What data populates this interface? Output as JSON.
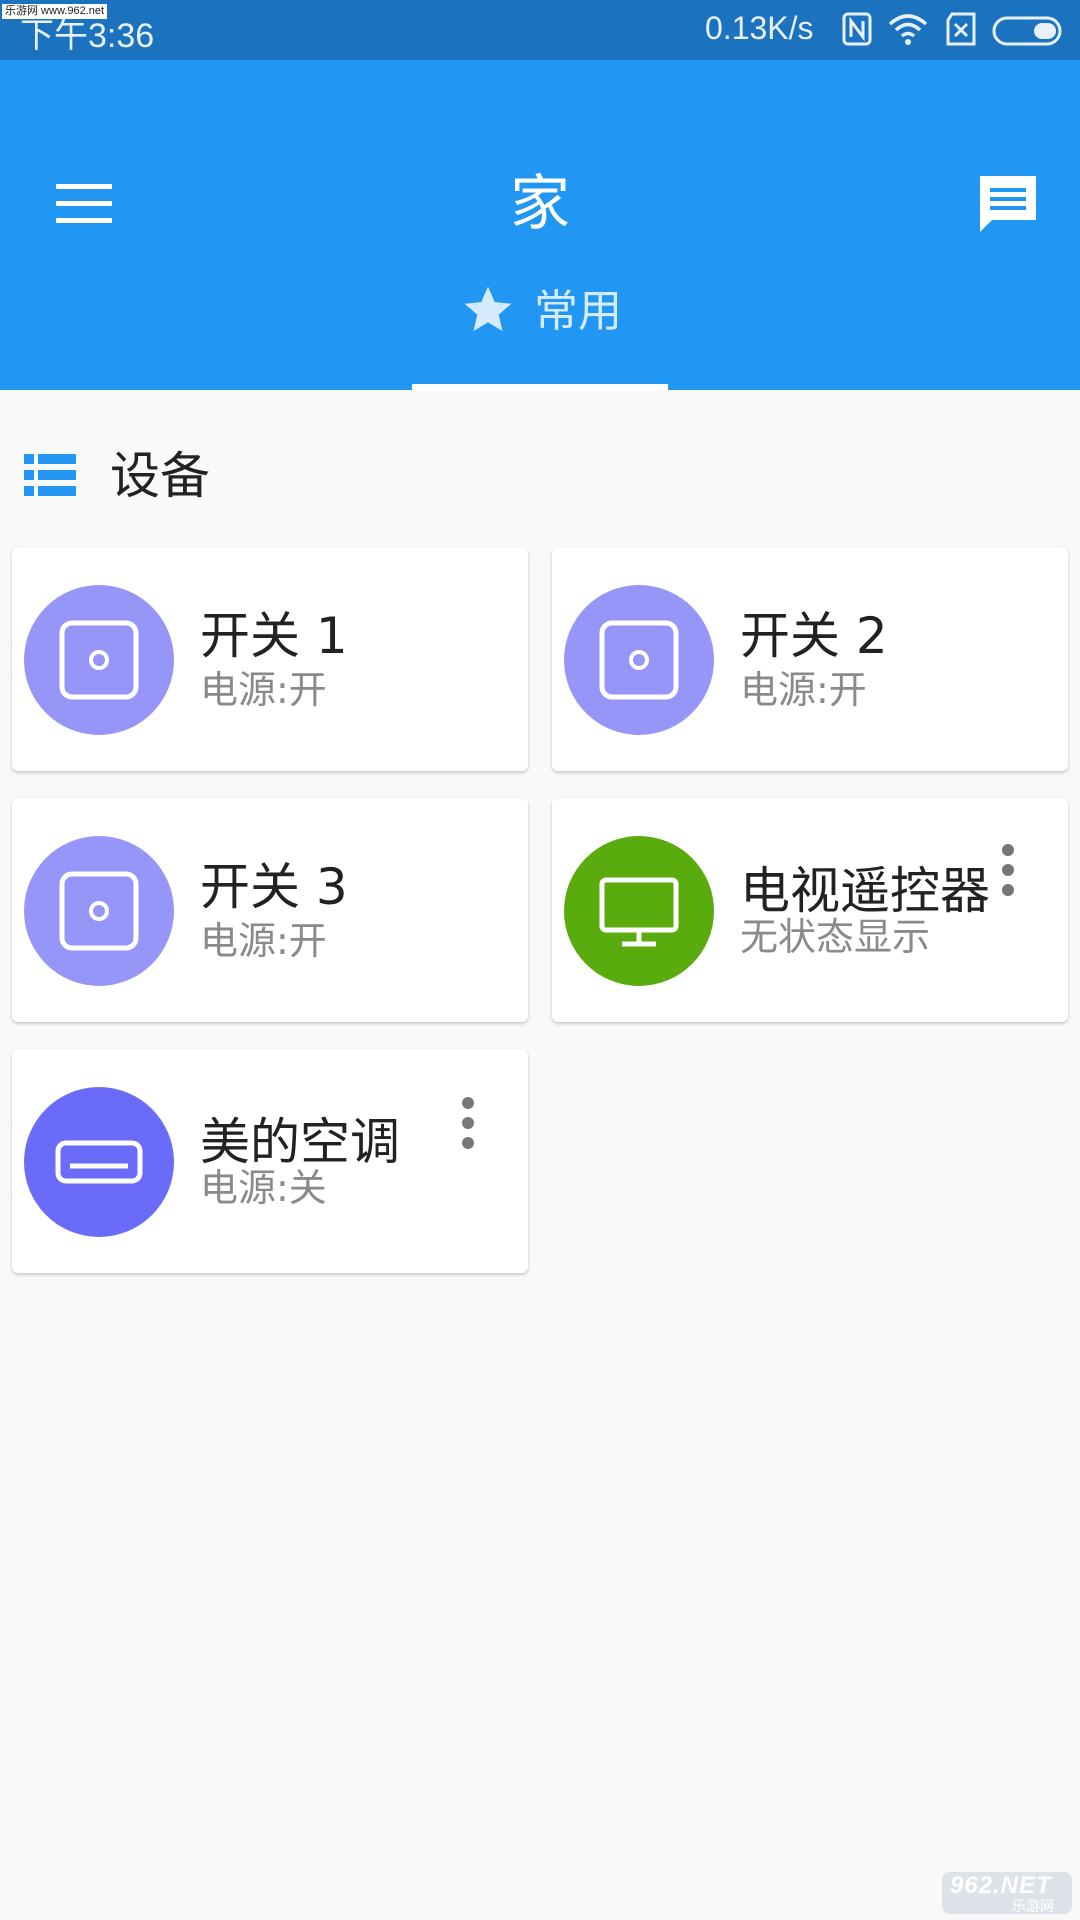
{
  "status_bar": {
    "time": "下午3:36",
    "speed": "0.13K/s",
    "watermark": "乐游网 www.962.net"
  },
  "app_bar": {
    "title": "家",
    "menu_icon": "hamburger-menu-icon",
    "message_icon": "message-icon",
    "color": "#2196f3"
  },
  "tabs": [
    {
      "label": "常用",
      "icon": "star-icon",
      "selected": true
    }
  ],
  "section": {
    "title": "设备",
    "icon": "list-icon"
  },
  "devices": [
    {
      "name": "开关 1",
      "status": "电源:开",
      "icon": "switch-icon",
      "color": "#9696f8",
      "has_menu": false
    },
    {
      "name": "开关 2",
      "status": "电源:开",
      "icon": "switch-icon",
      "color": "#9696f8",
      "has_menu": false
    },
    {
      "name": "开关 3",
      "status": "电源:开",
      "icon": "switch-icon",
      "color": "#9696f8",
      "has_menu": false
    },
    {
      "name": "电视遥控器",
      "status": "无状态显示",
      "icon": "tv-icon",
      "color": "#5aab0d",
      "has_menu": true
    },
    {
      "name": "美的空调",
      "status": "电源:关",
      "icon": "air-conditioner-icon",
      "color": "#6b6bfa",
      "has_menu": true
    }
  ],
  "watermark_bottom": {
    "brand": "962.NET",
    "sub": "乐游网"
  }
}
